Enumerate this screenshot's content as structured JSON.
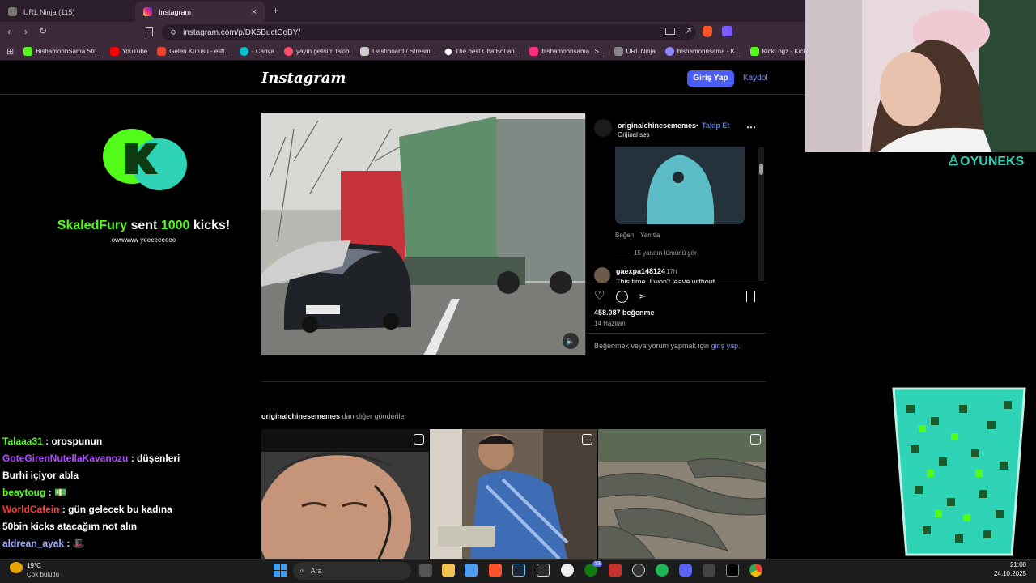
{
  "browser": {
    "tabs": [
      {
        "label": "URL Ninja (115)",
        "active": false,
        "color": "#888888"
      },
      {
        "label": "Instagram",
        "active": true,
        "color": "#e1306c"
      }
    ],
    "new_tab": "+",
    "url": "instagram.com/p/DK5BuctCoBY/",
    "bookmarks": [
      {
        "label": "BishamonnSama Str...",
        "color": "#53fc18"
      },
      {
        "label": "YouTube",
        "color": "#ff0000"
      },
      {
        "label": "Gelen Kutusu - elift...",
        "color": "#ea4335"
      },
      {
        "label": "- Canva",
        "color": "#00c4cc"
      },
      {
        "label": "yayın gelişim takibi",
        "color": "#ff4d6d"
      },
      {
        "label": "Dashboard / Stream...",
        "color": "#cccccc"
      },
      {
        "label": "The best ChatBot an...",
        "color": "#ffffff"
      },
      {
        "label": "bishamonnsama | S...",
        "color": "#ff2e7e"
      },
      {
        "label": "URL Ninja",
        "color": "#888888"
      },
      {
        "label": "bishamonnsama - K...",
        "color": "#8b8bff"
      },
      {
        "label": "KickLogz - Kick Yay...",
        "color": "#53fc18"
      }
    ]
  },
  "instagram": {
    "logo": "Instagram",
    "login": "Giriş Yap",
    "signup": "Kaydol",
    "post": {
      "username": "originalchinesememes",
      "dot": "•",
      "follow": "Takip Et",
      "audio": "Orijinal ses",
      "comment_actions": {
        "like": "Beğen",
        "reply": "Yanıtla"
      },
      "replies": "15 yanıtın tümünü gör",
      "commenter": "gaexpa148124",
      "comment_time": "17h",
      "comment_text": "This time, I won't leave without",
      "likes": "458.087 beğenme",
      "date": "14 Haziran",
      "login_prompt_prefix": "Beğenmek veya yorum yapmak için ",
      "login_prompt_link": "giriş yap",
      "login_prompt_suffix": "."
    },
    "more_posts": {
      "username": "originalchinesememes",
      "suffix": " dan diğer gönderiler"
    }
  },
  "stream": {
    "alert_user": "SkaledFury",
    "alert_sent": " sent ",
    "alert_amount": "1000",
    "alert_unit": " kicks!",
    "alert_message": "owwwww yeeeeeeeee",
    "brand": "OYUNEKS",
    "chat": [
      {
        "user": "Talaaa31",
        "color": "#53fc18",
        "text": " : orospunun"
      },
      {
        "user": "GoteGirenNutellaKavanozu",
        "color": "#b04bff",
        "text": " : düşenleri"
      },
      {
        "user": "",
        "color": "#ffffff",
        "text": "Burhi içiyor abla"
      },
      {
        "user": "beaytoug",
        "color": "#53fc18",
        "text": " : 💵"
      },
      {
        "user": "WorldCafein",
        "color": "#ff3b3b",
        "text": " : gün gelecek bu kadına"
      },
      {
        "user": "",
        "color": "#ffffff",
        "text": "50bin kicks atacağım not alın"
      },
      {
        "user": "aldrean_ayak",
        "color": "#9fa8ff",
        "text": " : 🎩"
      }
    ]
  },
  "taskbar": {
    "weather_temp": "19°C",
    "weather_desc": "Çok bulutlu",
    "search_label": "Ara",
    "time": "21:00",
    "date": "24.10.2025",
    "discord_badge": "13"
  }
}
